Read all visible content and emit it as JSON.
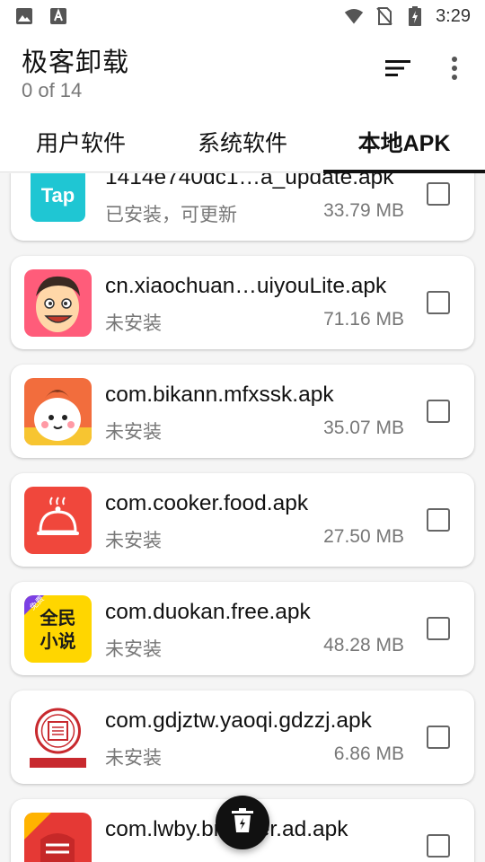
{
  "status_bar": {
    "time": "3:29",
    "icons_left": [
      "image-icon",
      "font-a-icon"
    ],
    "icons_right": [
      "wifi-icon",
      "no-sim-icon",
      "battery-charging-icon"
    ]
  },
  "app_bar": {
    "title": "极客卸载",
    "subtitle": "0 of 14",
    "actions": [
      "sort-icon",
      "more-vert-icon"
    ]
  },
  "tabs": [
    {
      "label": "用户软件",
      "active": false
    },
    {
      "label": "系统软件",
      "active": false
    },
    {
      "label": "本地APK",
      "active": true
    }
  ],
  "apk_list": [
    {
      "name": "1414e740dc1…a_update.apk",
      "status": "已安装，可更新",
      "size": "33.79 MB",
      "icon": "taptap-icon",
      "checked": false
    },
    {
      "name": "cn.xiaochuan…uiyouLite.apk",
      "status": "未安装",
      "size": "71.16 MB",
      "icon": "zuiyou-face-icon",
      "checked": false
    },
    {
      "name": "com.bikann.mfxssk.apk",
      "status": "未安装",
      "size": "35.07 MB",
      "icon": "cartoon-character-icon",
      "checked": false
    },
    {
      "name": "com.cooker.food.apk",
      "status": "未安装",
      "size": "27.50 MB",
      "icon": "food-cloche-icon",
      "checked": false
    },
    {
      "name": "com.duokan.free.apk",
      "status": "未安装",
      "size": "48.28 MB",
      "icon": "duokan-novel-icon",
      "checked": false,
      "icon_text": [
        "全民",
        "小说"
      ],
      "icon_badge": "免费"
    },
    {
      "name": "com.gdjztw.yaoqi.gdzzj.apk",
      "status": "未安装",
      "size": "6.86 MB",
      "icon": "medicine-seal-icon",
      "checked": false
    },
    {
      "name": "com.lwby.breader.ad.apk",
      "status": "",
      "size": "",
      "icon": "breader-icon",
      "checked": false
    }
  ],
  "fab": {
    "icon": "delete-icon"
  },
  "colors": {
    "background": "#f5f5f5",
    "card": "#ffffff",
    "accent": "#111111",
    "secondary_text": "#777777"
  }
}
